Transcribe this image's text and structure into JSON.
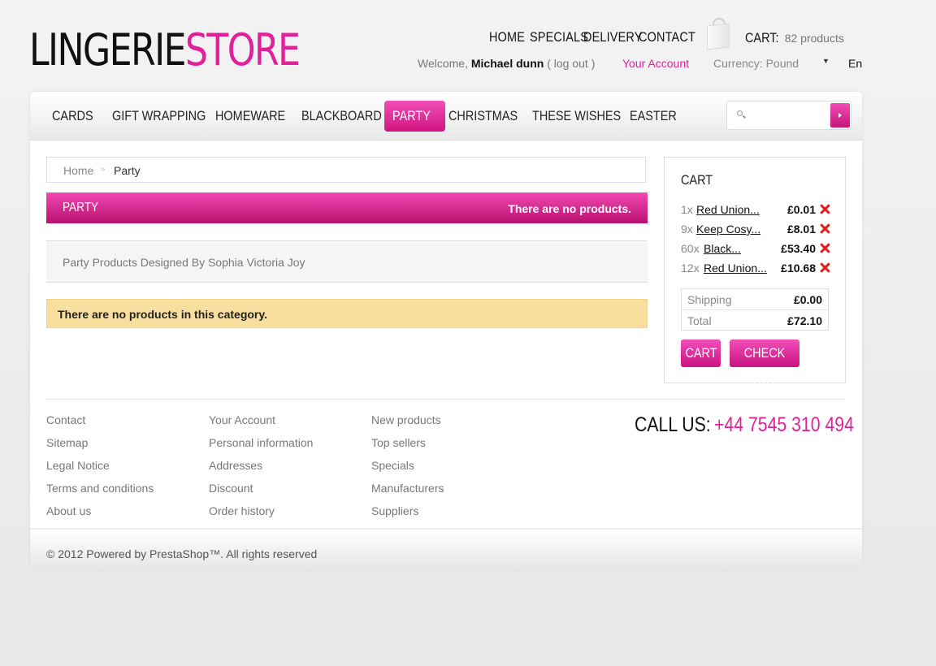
{
  "brand": {
    "part1": "LINGERIE",
    "part2": "STORE"
  },
  "top_nav": [
    "HOME",
    "SPECIALS",
    "DELIVERY",
    "CONTACT"
  ],
  "cart_summary": {
    "label": "CART:",
    "count": "82 products"
  },
  "user": {
    "welcome": "Welcome,",
    "name": "Michael dunn",
    "logout": "( log out )",
    "account_link": "Your Account"
  },
  "currency": {
    "label": "Currency:",
    "value": "Pound"
  },
  "language": "En",
  "menu": [
    "CARDS",
    "GIFT WRAPPING",
    "HOMEWARE",
    "BLACKBOARD",
    "PARTY",
    "CHRISTMAS",
    "THESE WISHES",
    "EASTER"
  ],
  "menu_active": "PARTY",
  "search": {
    "placeholder": "",
    "value": ""
  },
  "breadcrumb": {
    "home": "Home",
    "sep": "»",
    "current": "Party"
  },
  "category": {
    "name": "PARTY",
    "product_count_text": "There are no products.",
    "description": "Party Products Designed By Sophia Victoria Joy",
    "empty_message": "There are no products in this category."
  },
  "cart": {
    "title": "CART",
    "items": [
      {
        "qty": "1x",
        "name": "Red Union...",
        "price": "£0.01"
      },
      {
        "qty": "9x",
        "name": "Keep Cosy...",
        "price": "£8.01"
      },
      {
        "qty": "60x",
        "name": "Black...",
        "price": "£53.40"
      },
      {
        "qty": "12x",
        "name": "Red Union...",
        "price": "£10.68"
      }
    ],
    "shipping_label": "Shipping",
    "shipping_value": "£0.00",
    "total_label": "Total",
    "total_value": "£72.10",
    "cart_button": "CART",
    "checkout_button": "CHECK OUT"
  },
  "footer": {
    "col1": [
      "Contact",
      "Sitemap",
      "Legal Notice",
      "Terms and conditions",
      "About us"
    ],
    "col2": [
      "Your Account",
      "Personal information",
      "Addresses",
      "Discount",
      "Order history"
    ],
    "col3": [
      "New products",
      "Top sellers",
      "Specials",
      "Manufacturers",
      "Suppliers"
    ],
    "call_label": "CALL US:",
    "phone": "+44 7545 310 494",
    "copyright": "© 2012 Powered by PrestaShop™. All rights reserved"
  },
  "colors": {
    "accent": "#e0219a",
    "warning_bg": "#f8df9f",
    "remove": "#e02020"
  },
  "icons": [
    "shopping-bag-icon",
    "search-icon",
    "arrow-right-icon",
    "remove-x-icon",
    "chevron-down-icon"
  ]
}
